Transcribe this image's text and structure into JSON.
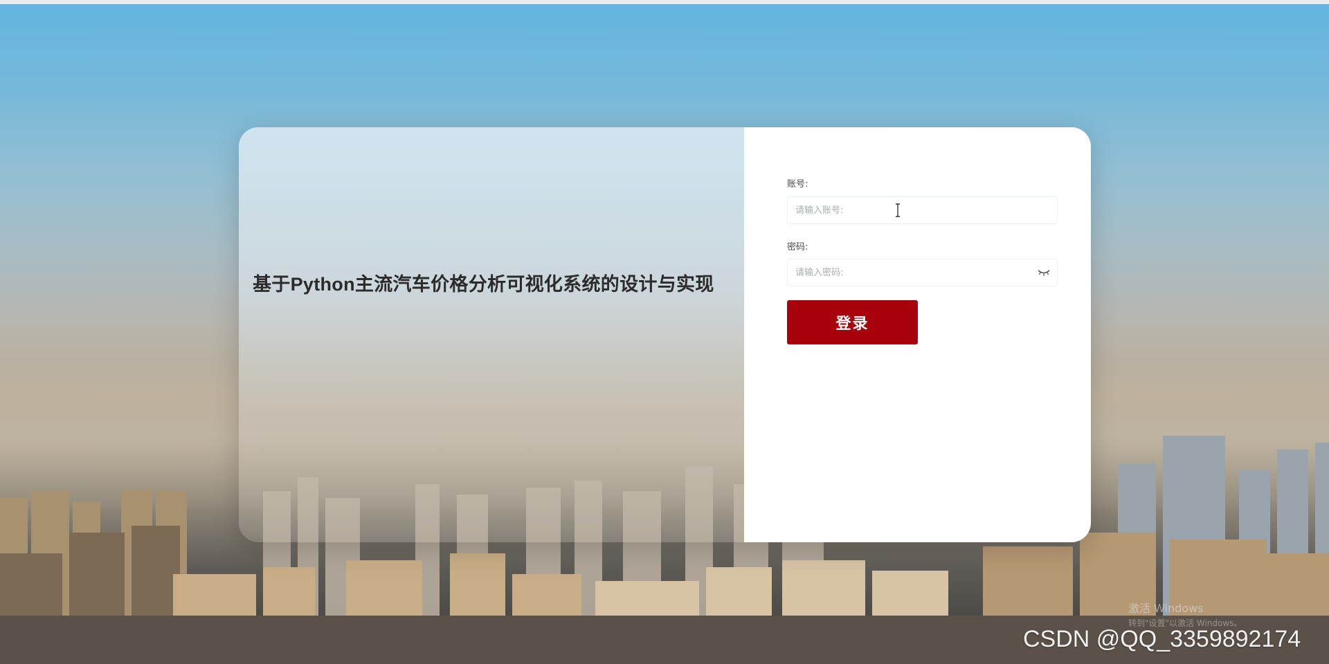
{
  "system_title": "基于Python主流汽车价格分析可视化系统的设计与实现",
  "form": {
    "account_label": "账号:",
    "account_placeholder": "请输入账号:",
    "account_value": "",
    "password_label": "密码:",
    "password_placeholder": "请输入密码:",
    "password_value": "",
    "login_label": "登录"
  },
  "icons": {
    "password_toggle": "eye-closed-icon",
    "cursor": "text-cursor-icon"
  },
  "watermarks": {
    "csdn": "CSDN @QQ_3359892174",
    "activate_title": "激活 Windows",
    "activate_sub": "转到\"设置\"以激活 Windows。"
  },
  "colors": {
    "login_button": "#a8030d",
    "card_right": "#ffffff",
    "title_text": "#2b2b2b"
  }
}
